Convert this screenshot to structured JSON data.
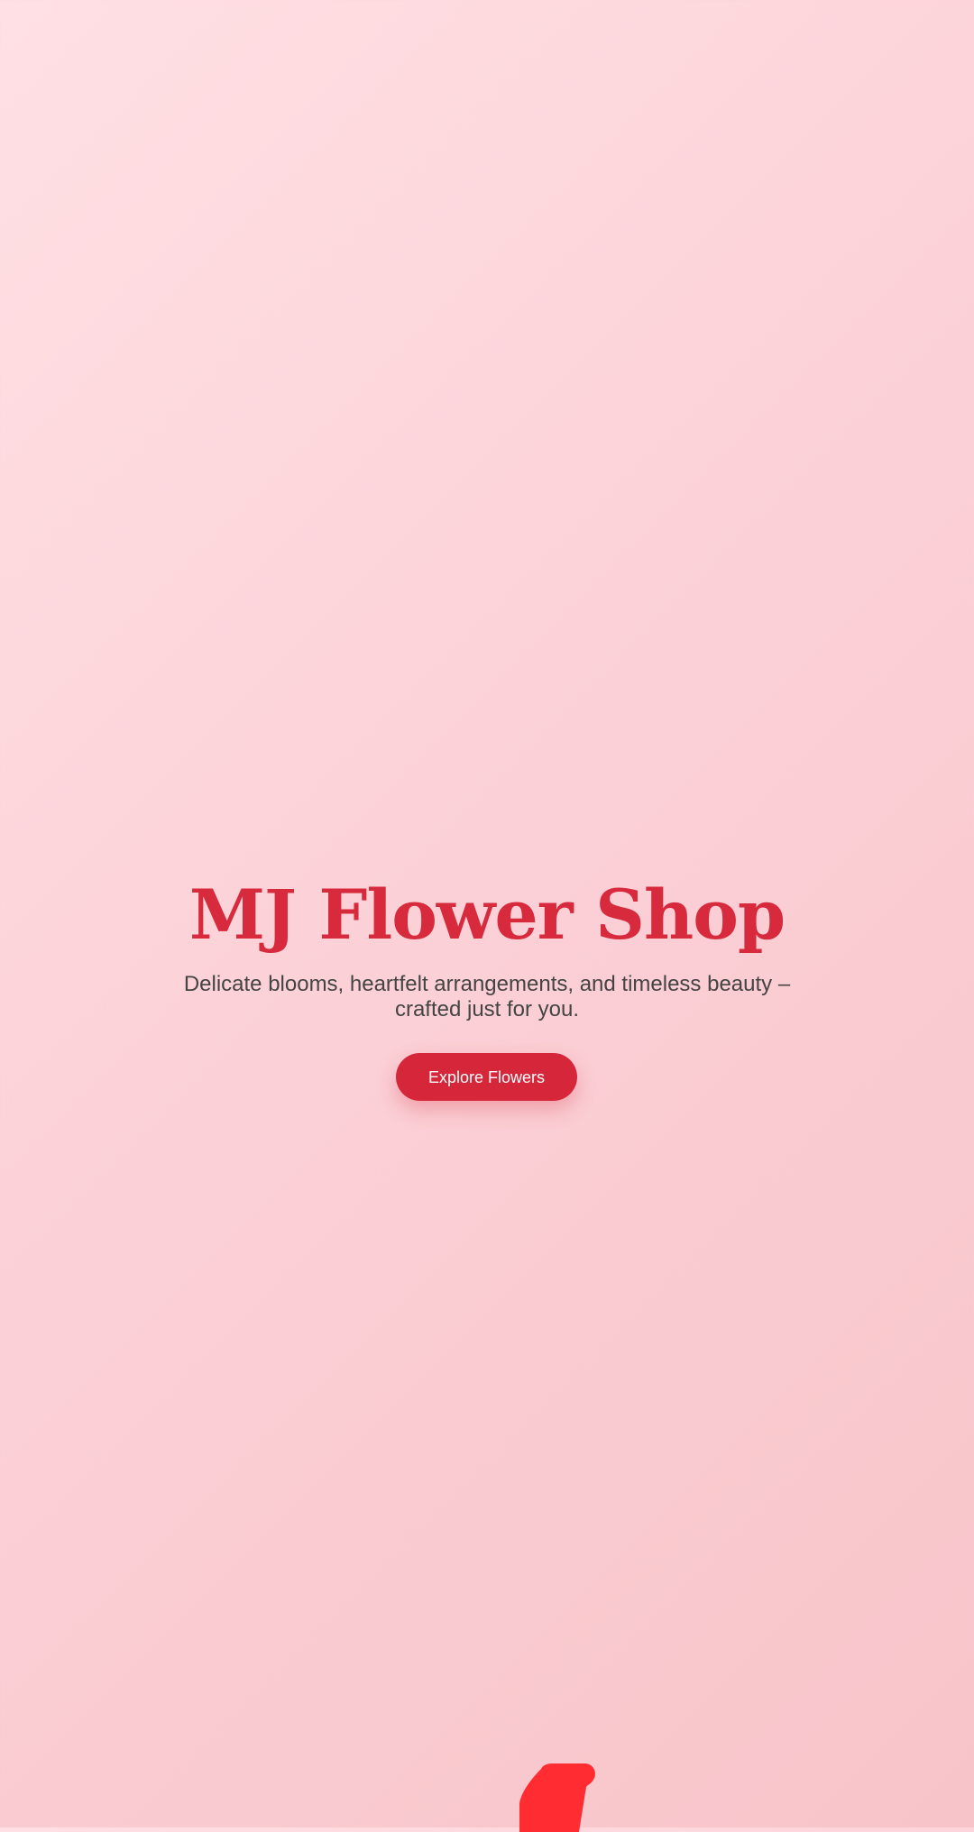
{
  "hero": {
    "title": "MJ Flower Shop",
    "subtitle": "Delicate blooms, heartfelt arrangements, and timeless beauty – crafted just for you.",
    "cta_label": "Explore Flowers"
  },
  "colors": {
    "background_start": "#ffe0e4",
    "background_end": "#f7c4c9",
    "accent": "#d6263a",
    "title": "#d72a3c",
    "subtitle": "#444444",
    "button_text": "#ffffff",
    "petal": "#ff2d32"
  },
  "decor": {
    "petal_icon": "petal-icon"
  }
}
